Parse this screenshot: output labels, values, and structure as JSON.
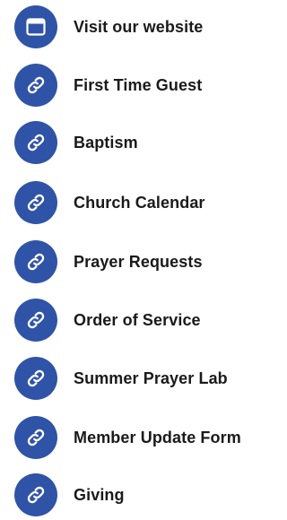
{
  "colors": {
    "accent": "#2f53a6",
    "text": "#1a1a1a",
    "background": "#ffffff"
  },
  "links": [
    {
      "label": "Visit our website",
      "icon": "browser-window-icon"
    },
    {
      "label": "First Time Guest",
      "icon": "link-icon"
    },
    {
      "label": "Baptism",
      "icon": "link-icon"
    },
    {
      "label": "Church Calendar",
      "icon": "link-icon"
    },
    {
      "label": "Prayer Requests",
      "icon": "link-icon"
    },
    {
      "label": "Order of Service",
      "icon": "link-icon"
    },
    {
      "label": "Summer Prayer Lab",
      "icon": "link-icon"
    },
    {
      "label": "Member Update Form",
      "icon": "link-icon"
    },
    {
      "label": "Giving",
      "icon": "link-icon"
    }
  ]
}
